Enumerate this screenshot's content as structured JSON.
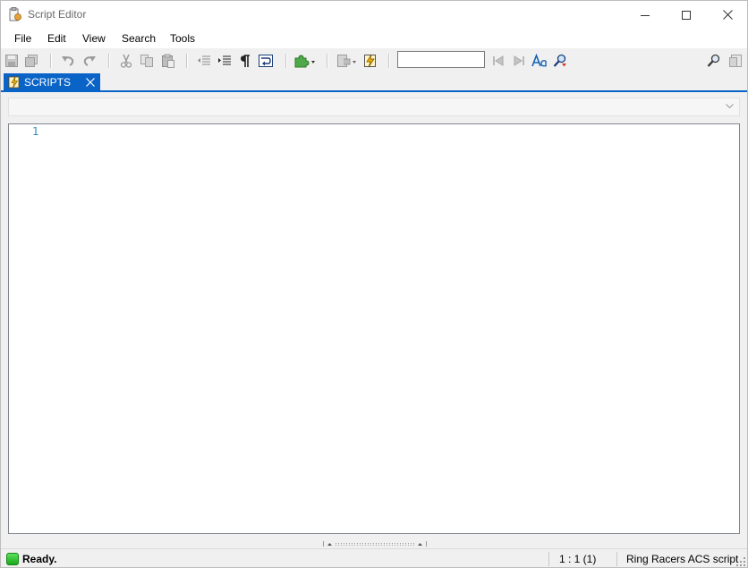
{
  "window": {
    "title": "Script Editor"
  },
  "menu": {
    "items": [
      "File",
      "Edit",
      "View",
      "Search",
      "Tools"
    ]
  },
  "toolbar": {
    "search": {
      "value": "",
      "placeholder": ""
    }
  },
  "tabs": [
    {
      "label": "SCRIPTS",
      "active": true
    }
  ],
  "script_select": {
    "value": ""
  },
  "editor": {
    "line_numbers": [
      "1"
    ]
  },
  "status": {
    "message": "Ready.",
    "position": "1 : 1 (1)",
    "language": "Ring Racers ACS script"
  },
  "colors": {
    "accent": "#0a64c8",
    "line_number": "#2b8fbd",
    "status_ok": "#18a818"
  }
}
